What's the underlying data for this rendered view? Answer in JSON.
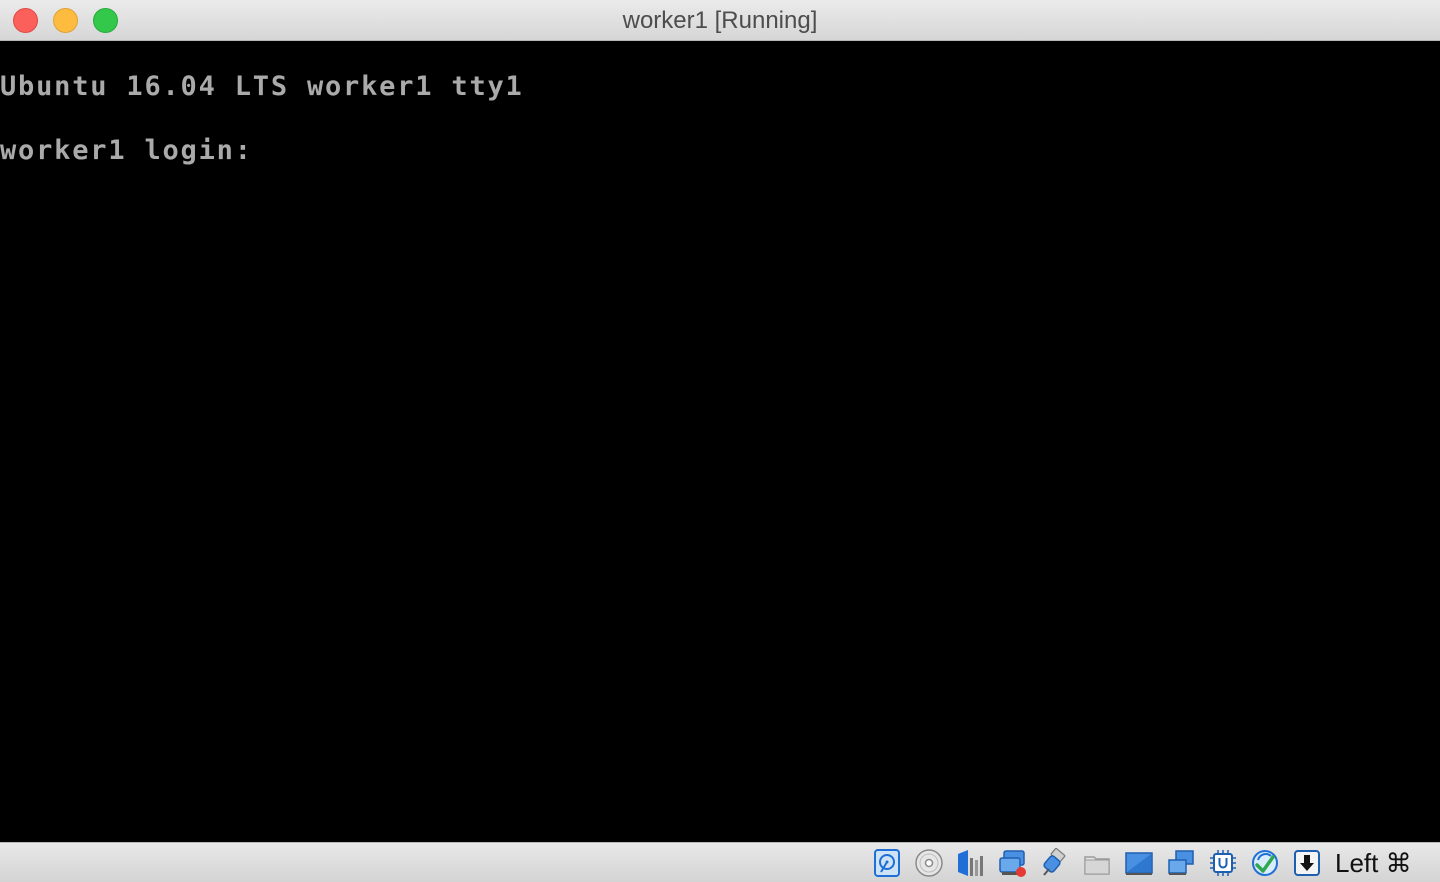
{
  "window": {
    "title": "worker1 [Running]"
  },
  "console": {
    "lines": [
      "Ubuntu 16.04 LTS worker1 tty1",
      "worker1 login: "
    ],
    "text_color": "#aaaaaa",
    "background": "#000000"
  },
  "statusbar": {
    "icons": [
      "hard-disk-icon",
      "optical-disk-icon",
      "audio-icon",
      "network-icon",
      "usb-icon",
      "shared-folder-icon",
      "display-icon",
      "video-capture-icon",
      "cpu-icon",
      "mouse-integration-icon",
      "keyboard-capture-icon"
    ],
    "host_key": "Left ⌘"
  },
  "colors": {
    "close": "#fc605b",
    "minimize": "#fdbc40",
    "zoom": "#34c84a",
    "accent": "#1f6fd6"
  }
}
